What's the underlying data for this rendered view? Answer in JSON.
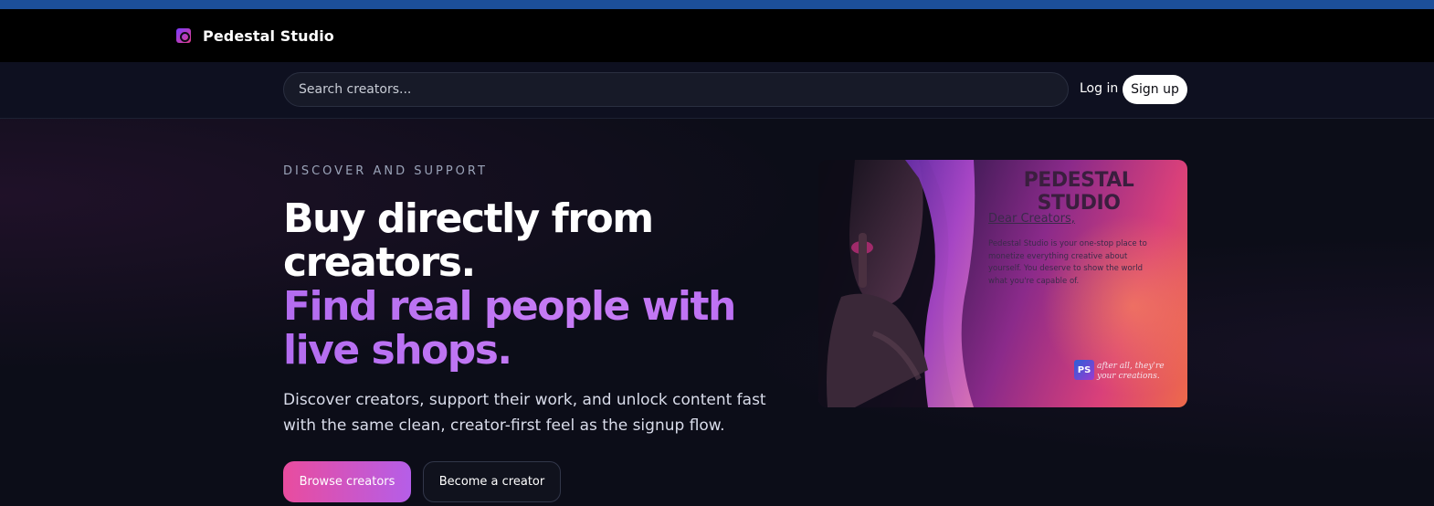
{
  "brand": {
    "name": "Pedestal Studio"
  },
  "search": {
    "placeholder": "Search creators..."
  },
  "auth": {
    "login_label": "Log in",
    "signup_label": "Sign up"
  },
  "hero": {
    "eyebrow": "DISCOVER AND SUPPORT",
    "headline_line1": "Buy directly from creators.",
    "headline_line2": "Find real people with live shops.",
    "subtext": "Discover creators, support their work, and unlock content fast with the same clean, creator-first feel as the signup flow.",
    "primary_cta": "Browse creators",
    "secondary_cta": "Become a creator"
  },
  "promo": {
    "title": "PEDESTAL STUDIO",
    "greeting": "Dear Creators,",
    "body": "Pedestal Studio is your one-stop place to monetize everything creative about yourself. You deserve to show the world what you're capable of.",
    "logo_text": "PS",
    "tagline": "after all, they're your creations."
  },
  "colors": {
    "browser_strip": "#1c4f9a",
    "topbar": "#000000",
    "background": "#0c0d18",
    "accent_purple": "#b86bf2",
    "accent_pink": "#e94c9e"
  }
}
